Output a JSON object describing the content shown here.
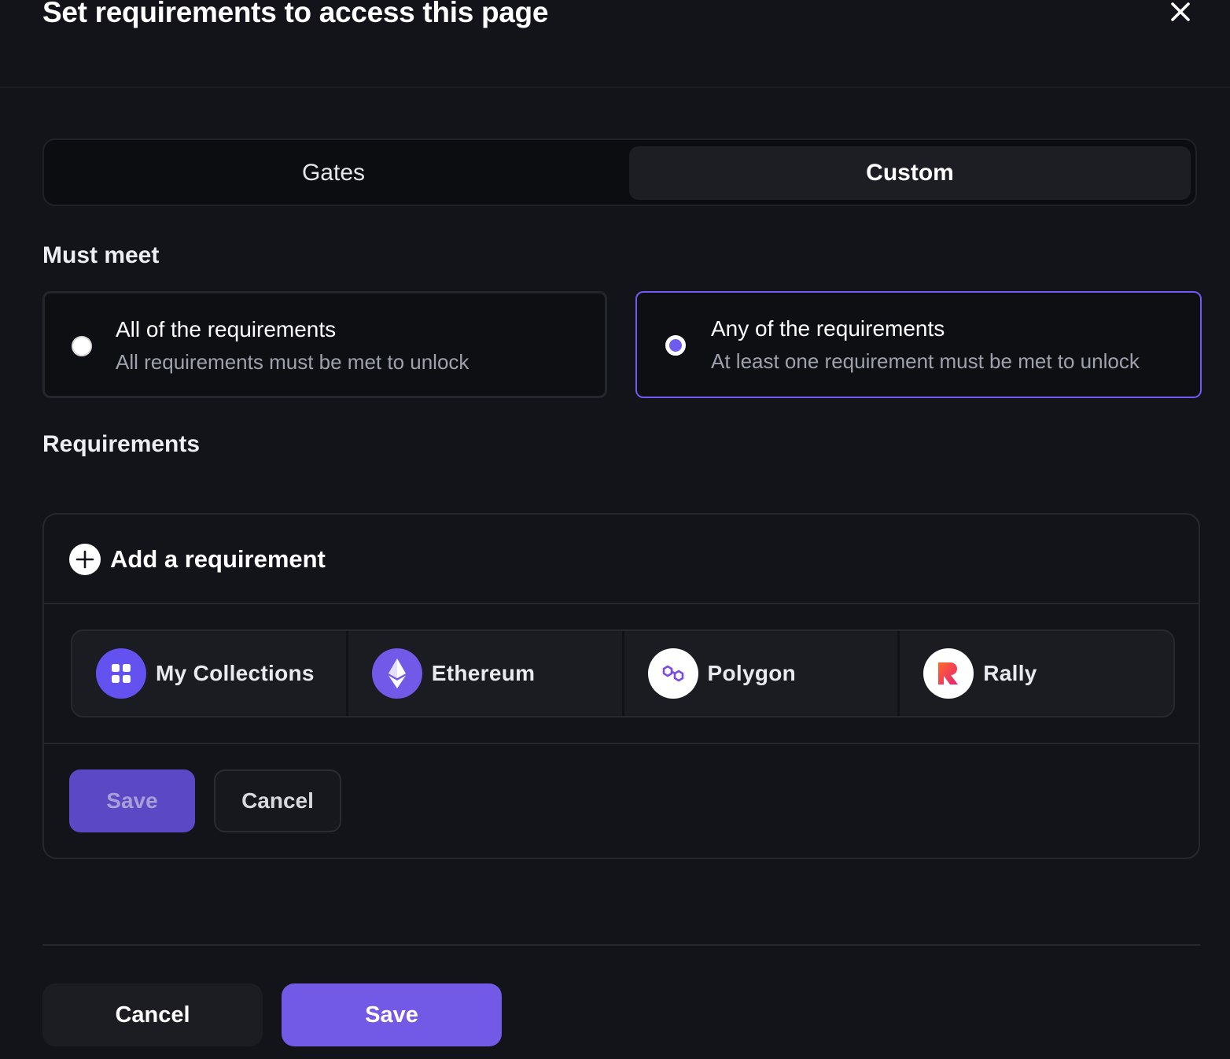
{
  "dialog": {
    "title": "Set requirements to access this page",
    "close_icon": "close-icon"
  },
  "tabs": [
    {
      "label": "Gates",
      "selected": false
    },
    {
      "label": "Custom",
      "selected": true
    }
  ],
  "must_meet": {
    "label": "Must meet",
    "options": [
      {
        "title": "All of the requirements",
        "description": "All requirements must be met to unlock",
        "selected": false
      },
      {
        "title": "Any of the requirements",
        "description": "At least one requirement must be met to unlock",
        "selected": true
      }
    ]
  },
  "requirements": {
    "label": "Requirements",
    "add_label": "Add a requirement",
    "add_icon": "plus-circle-icon",
    "chains": [
      {
        "label": "My Collections",
        "icon": "grid-icon",
        "icon_bg": "#6352f0"
      },
      {
        "label": "Ethereum",
        "icon": "ethereum-icon",
        "icon_bg": "#7259e8"
      },
      {
        "label": "Polygon",
        "icon": "polygon-icon",
        "icon_bg": "#ffffff"
      },
      {
        "label": "Rally",
        "icon": "rally-icon",
        "icon_bg": "#ffffff"
      }
    ],
    "save_label": "Save",
    "cancel_label": "Cancel"
  },
  "footer": {
    "cancel_label": "Cancel",
    "save_label": "Save"
  },
  "colors": {
    "background": "#131419",
    "accent": "#735ae6",
    "accent_border": "#6e5cf0"
  }
}
